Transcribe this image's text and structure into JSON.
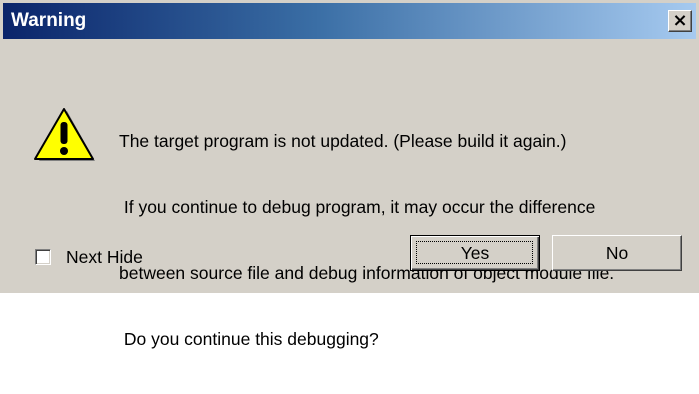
{
  "dialog": {
    "title": "Warning",
    "close_glyph": "×",
    "icon": "warning-icon",
    "message_lines": [
      "The target program is not updated. (Please build it again.)",
      " If you continue to debug program, it may occur the difference",
      "between source file and debug information of object module file.",
      " Do you continue this debugging?"
    ],
    "checkbox": {
      "label": "Next Hide",
      "checked": false
    },
    "buttons": {
      "yes_label": "Yes",
      "no_label": "No"
    }
  },
  "colors": {
    "titlebar_start": "#0a246a",
    "titlebar_end": "#a6caf0",
    "face": "#d4d0c8",
    "warning_yellow": "#ffff00"
  }
}
